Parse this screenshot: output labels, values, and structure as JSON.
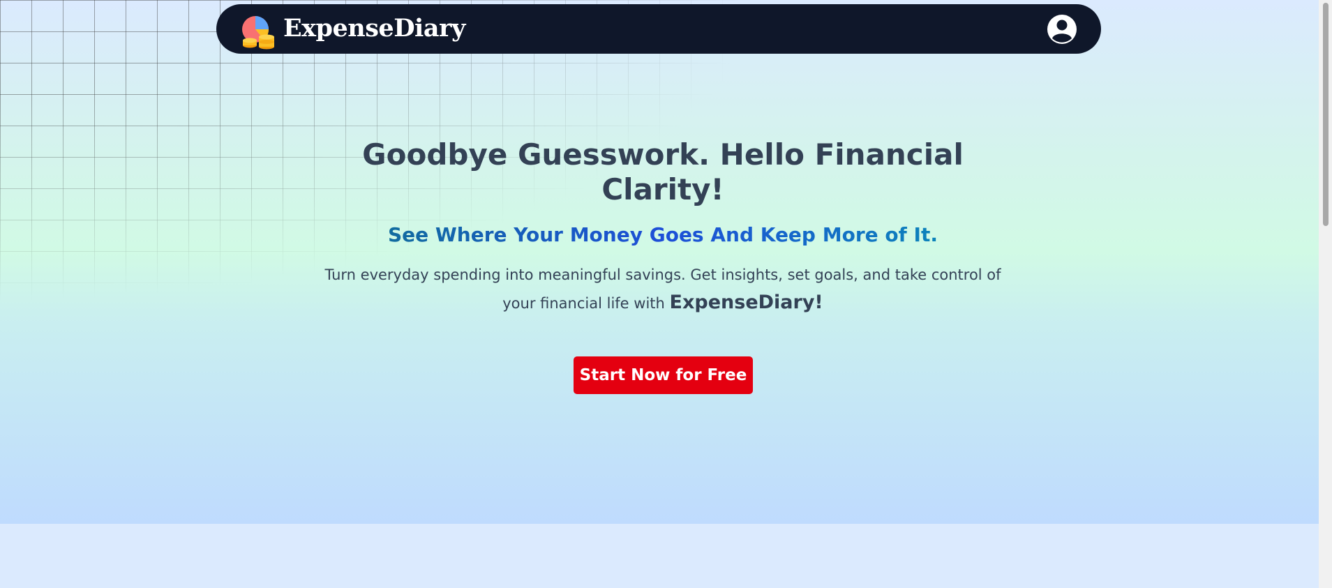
{
  "navbar": {
    "brand_name": "ExpenseDiary",
    "logo_icon": "pie-chart-coins-icon",
    "profile_icon": "user-circle-icon"
  },
  "hero": {
    "headline": "Goodbye Guesswork. Hello Financial Clarity!",
    "subheadline": "See Where Your Money Goes And Keep More of It.",
    "description_text": "Turn everyday spending into meaningful savings. Get insights, set goals, and take control of your financial life with",
    "description_brand": "ExpenseDiary!",
    "cta_label": "Start Now for Free"
  },
  "colors": {
    "navbar_bg": "#0f172a",
    "cta_bg": "#e40010",
    "heading_text": "#334155",
    "subheadline_gradient_start": "#0e7490",
    "subheadline_gradient_mid": "#1d4ed8"
  }
}
